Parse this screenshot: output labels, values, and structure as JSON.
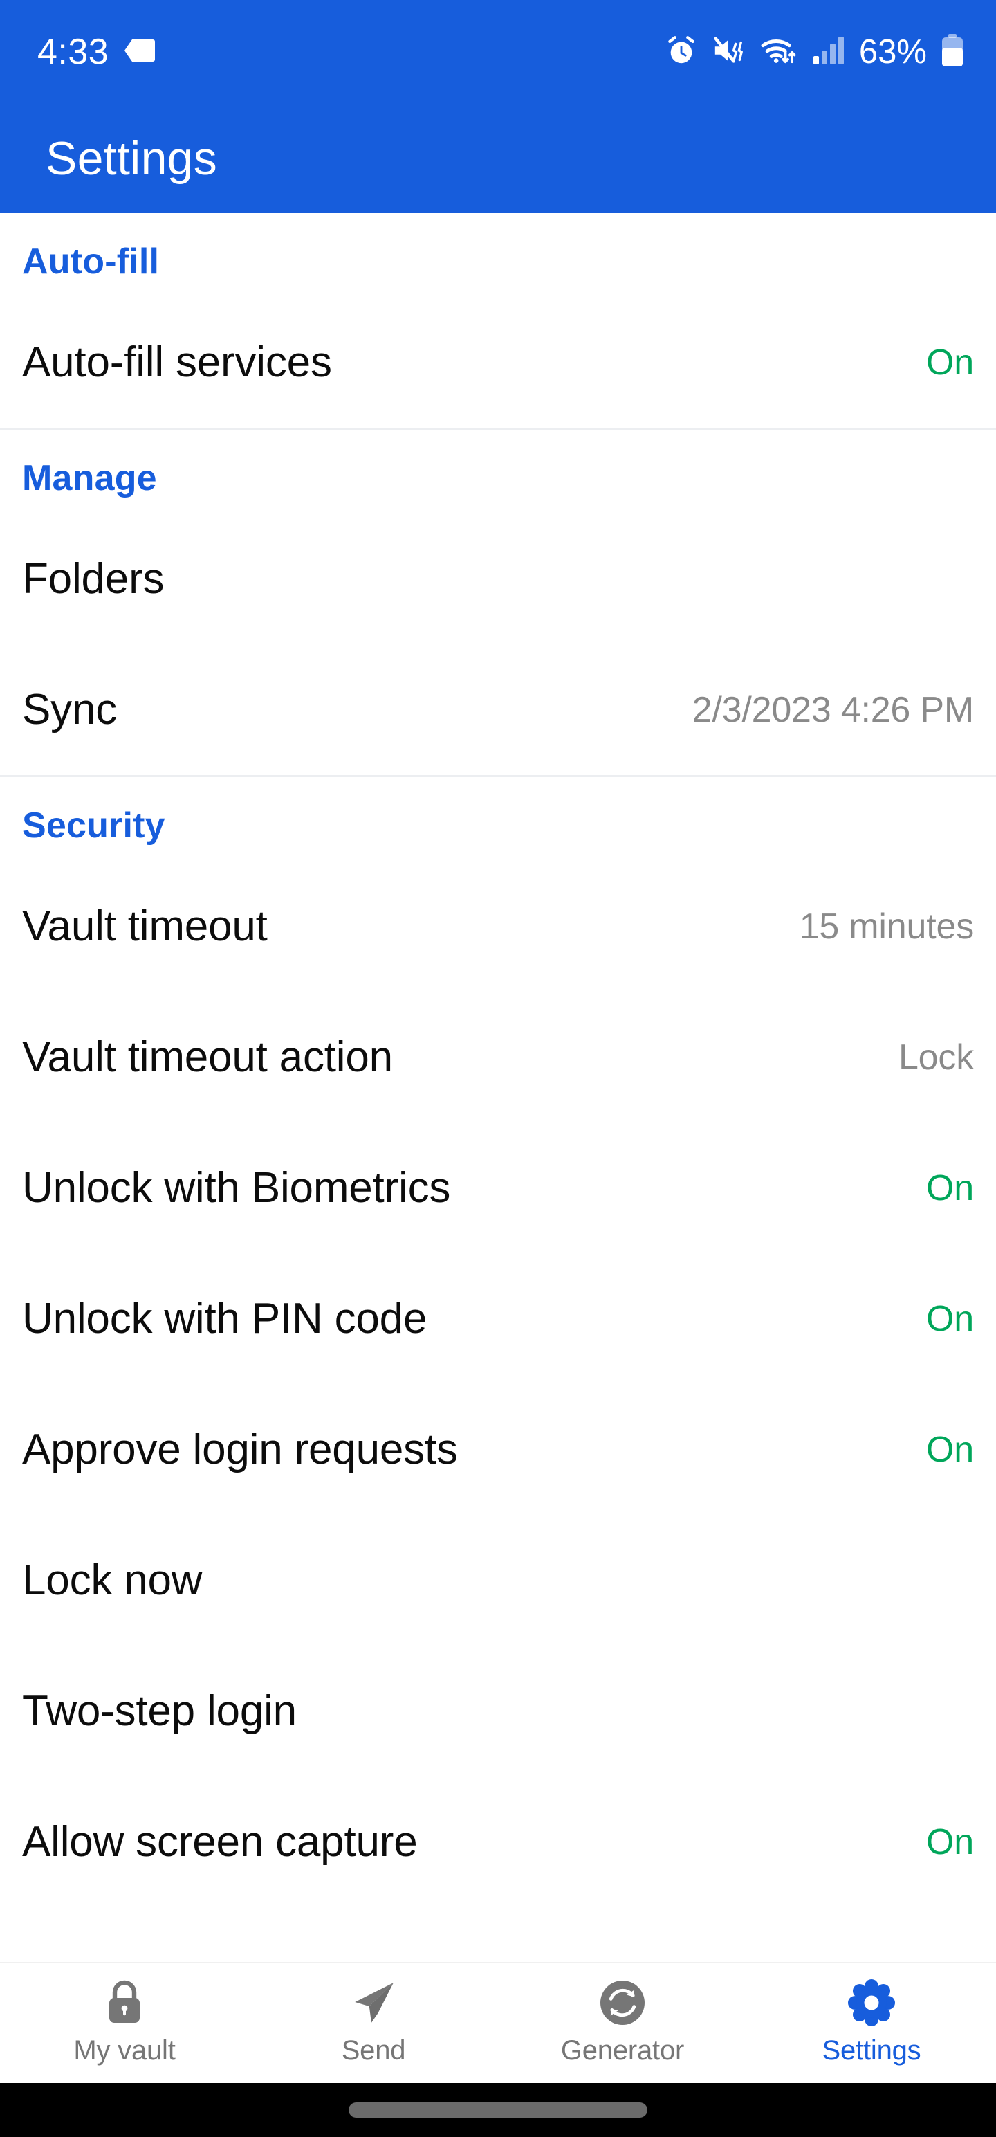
{
  "status_bar": {
    "time": "4:33",
    "battery_percent": "63%",
    "left_icons": [
      "tag-icon"
    ],
    "right_icons": [
      "alarm-icon",
      "mute-vibrate-icon",
      "wifi-icon",
      "cellular-signal-icon",
      "battery-icon"
    ]
  },
  "app_bar": {
    "title": "Settings"
  },
  "sections": [
    {
      "header": "Auto-fill",
      "items": [
        {
          "label": "Auto-fill services",
          "value": "On",
          "value_style": "on"
        }
      ]
    },
    {
      "header": "Manage",
      "items": [
        {
          "label": "Folders",
          "value": "",
          "value_style": "none"
        },
        {
          "label": "Sync",
          "value": "2/3/2023 4:26 PM",
          "value_style": "muted"
        }
      ]
    },
    {
      "header": "Security",
      "items": [
        {
          "label": "Vault timeout",
          "value": "15 minutes",
          "value_style": "muted"
        },
        {
          "label": "Vault timeout action",
          "value": "Lock",
          "value_style": "muted"
        },
        {
          "label": "Unlock with Biometrics",
          "value": "On",
          "value_style": "on"
        },
        {
          "label": "Unlock with PIN code",
          "value": "On",
          "value_style": "on"
        },
        {
          "label": "Approve login requests",
          "value": "On",
          "value_style": "on"
        },
        {
          "label": "Lock now",
          "value": "",
          "value_style": "none"
        },
        {
          "label": "Two-step login",
          "value": "",
          "value_style": "none"
        },
        {
          "label": "Allow screen capture",
          "value": "On",
          "value_style": "on"
        }
      ]
    }
  ],
  "tab_bar": {
    "tabs": [
      {
        "label": "My vault",
        "icon": "lock-icon",
        "active": false
      },
      {
        "label": "Send",
        "icon": "send-icon",
        "active": false
      },
      {
        "label": "Generator",
        "icon": "refresh-icon",
        "active": false
      },
      {
        "label": "Settings",
        "icon": "gear-icon",
        "active": true
      }
    ]
  },
  "colors": {
    "brand_blue": "#175DDC",
    "status_on_green": "#00a65a",
    "muted_gray": "#8a8a8a",
    "divider": "#eceef1"
  }
}
